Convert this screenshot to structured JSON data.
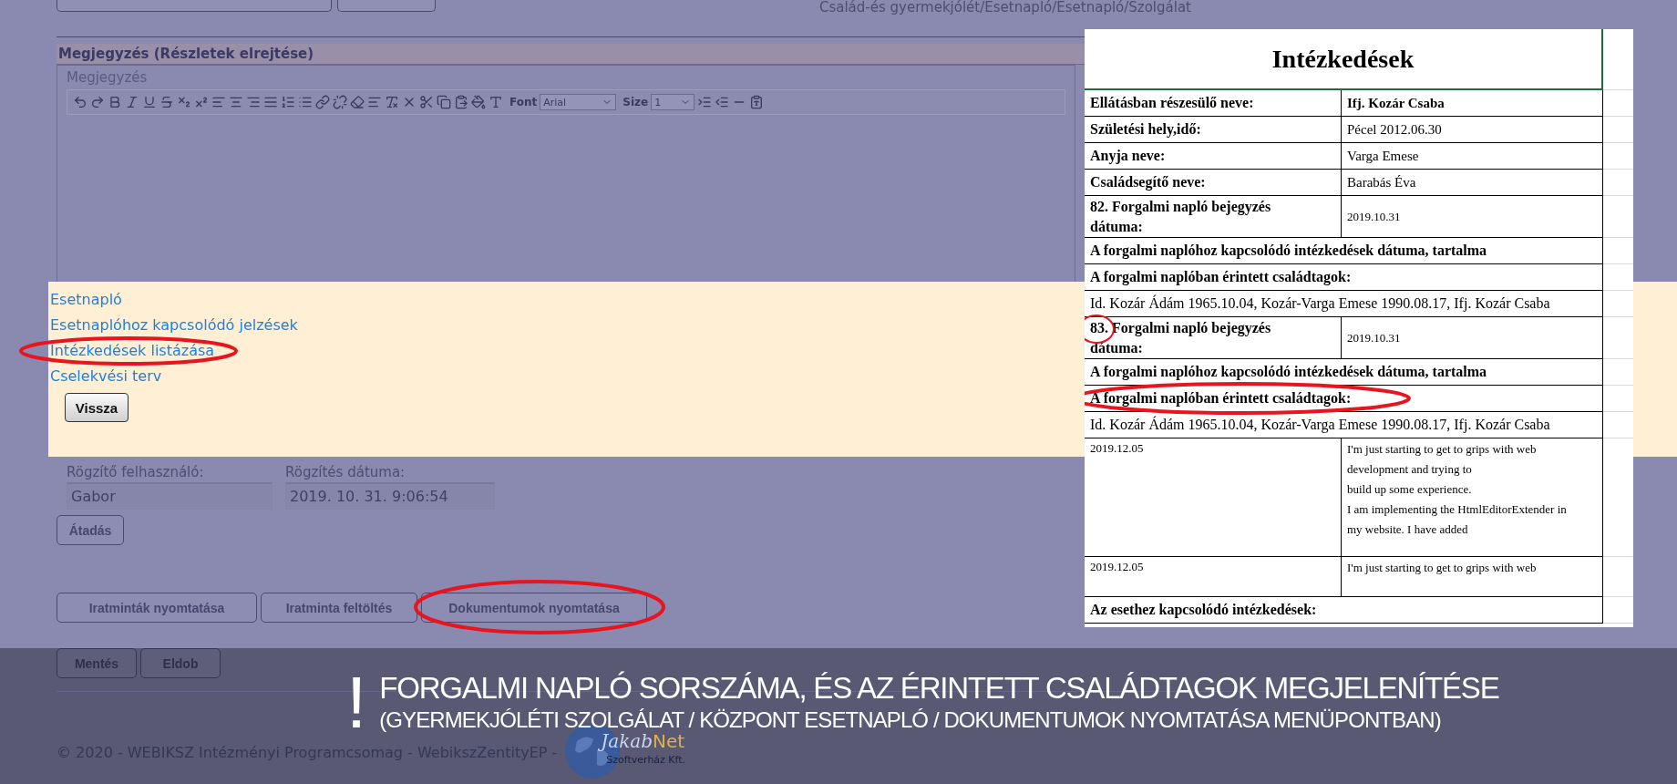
{
  "breadcrumb": "Család-és gyermekjólét/Esetnapló/Esetnapló/Szolgálat",
  "section_header": "Megjegyzés (Részletek elrejtése)",
  "editor": {
    "label": "Megjegyzés",
    "font_label": "Font",
    "font_value": "Arial",
    "size_label": "Size",
    "size_value": "1"
  },
  "menu_links": [
    {
      "label": "Esetnapló",
      "highlighted": false
    },
    {
      "label": "Esetnaplóhoz kapcsolódó jelzések",
      "highlighted": false
    },
    {
      "label": "Intézkedések listázása",
      "highlighted": true
    },
    {
      "label": "Cselekvési terv",
      "highlighted": false
    }
  ],
  "back_button": "Vissza",
  "fields": [
    {
      "label": "Rögzítő felhasználó:",
      "value": "Gabor"
    },
    {
      "label": "Rögzítés dátuma:",
      "value": "2019. 10. 31. 9:06:54"
    }
  ],
  "handover_button": "Átadás",
  "print_buttons": [
    {
      "label": "Iratminták nyomtatása",
      "highlighted": false
    },
    {
      "label": "Iratminta feltöltés",
      "highlighted": false
    },
    {
      "label": "Dokumentumok nyomtatása",
      "highlighted": true
    }
  ],
  "form_buttons": [
    "Mentés",
    "Eldob"
  ],
  "footer": "© 2020 - WEBIKSZ Intézményi Programcsomag - WebikszZentityEP -",
  "logo": {
    "name_1": "Jakab",
    "name_2": "Net",
    "subtitle": "Szoftverház Kft."
  },
  "document": {
    "title": "Intézkedések",
    "rows": [
      {
        "kind": "pair",
        "label": "Ellátásban részesülő neve:",
        "value": "Ifj. Kozár Csaba",
        "bold_value": true,
        "highlighted": false
      },
      {
        "kind": "pair",
        "label": "Születési hely,idő:",
        "value": "Pécel 2012.06.30",
        "bold_value": false,
        "highlighted": false
      },
      {
        "kind": "pair",
        "label": "Anyja neve:",
        "value": "Varga Emese",
        "bold_value": false,
        "highlighted": false
      },
      {
        "kind": "pair",
        "label": "Családsegítő neve:",
        "value": "Barabás Éva",
        "bold_value": false,
        "highlighted": false
      },
      {
        "kind": "pair",
        "label": "82. Forgalmi napló bejegyzés dátuma:",
        "value": "2019.10.31",
        "bold_value": false,
        "highlighted": false
      },
      {
        "kind": "heading",
        "text": "A  forgalmi naplóhoz kapcsolódó intézkedések dátuma, tartalma",
        "highlighted": false
      },
      {
        "kind": "heading",
        "text": "A forgalmi naplóban érintett családtagok:",
        "highlighted": false
      },
      {
        "kind": "text",
        "text": "Id. Kozár Ádám 1965.10.04, Kozár-Varga Emese 1990.08.17, Ifj. Kozár Csaba"
      },
      {
        "kind": "pair",
        "label": "83. Forgalmi napló bejegyzés dátuma:",
        "value": "2019.10.31",
        "bold_value": false,
        "highlighted": true
      },
      {
        "kind": "heading",
        "text": "A  forgalmi naplóhoz kapcsolódó intézkedések dátuma, tartalma",
        "highlighted": false
      },
      {
        "kind": "heading",
        "text": "A forgalmi naplóban érintett családtagok:",
        "highlighted": true
      },
      {
        "kind": "text",
        "text": "Id. Kozár Ádám 1965.10.04, Kozár-Varga Emese 1990.08.17, Ifj. Kozár Csaba"
      },
      {
        "kind": "entry",
        "date": "2019.12.05",
        "lines": [
          "I'm just starting to get to grips with web",
          "development and trying to",
          "build up some experience.",
          "I am implementing the HtmlEditorExtender in",
          "my website.  I have added"
        ]
      },
      {
        "kind": "entry",
        "date": "2019.12.05",
        "lines": [
          "I'm just starting to get to grips with web"
        ]
      },
      {
        "kind": "heading",
        "text": "Az esethez kapcsolódó intézkedések:",
        "highlighted": false
      }
    ]
  },
  "notice": {
    "mark": "!",
    "title": "FORGALMI NAPLÓ SORSZÁMA, ÉS AZ ÉRINTETT CSALÁDTAGOK MEGJELENÍTÉSE",
    "subtitle": "(GYERMEKJÓLÉTI SZOLGÁLAT / KÖZPONT ESETNAPLÓ / DOKUMENTUMOK NYOMTATÁSA MENÜPONTBAN)"
  }
}
